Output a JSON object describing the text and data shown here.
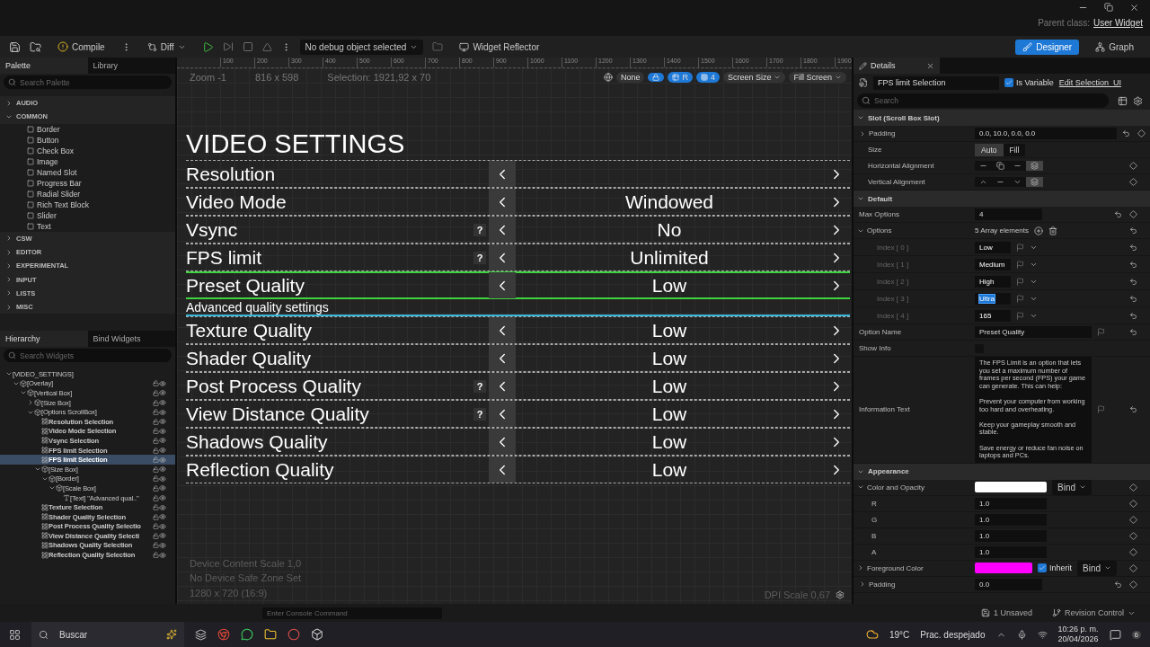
{
  "window": {
    "parent_class_label": "Parent class:",
    "parent_class": "User Widget",
    "modes": [
      {
        "label": "Designer",
        "selected": true
      },
      {
        "label": "Graph",
        "selected": false
      }
    ]
  },
  "toolbar": {
    "compile": "Compile",
    "diff": "Diff",
    "debug_object": "No debug object selected",
    "widget_reflector": "Widget Reflector"
  },
  "palette": {
    "tabs": [
      {
        "label": "Palette",
        "selected": true
      },
      {
        "label": "Library",
        "selected": false
      }
    ],
    "search_placeholder": "Search Palette",
    "categories": [
      {
        "label": "AUDIO",
        "expanded": false
      },
      {
        "label": "COMMON",
        "expanded": true,
        "items": [
          "Border",
          "Button",
          "Check Box",
          "Image",
          "Named Slot",
          "Progress Bar",
          "Radial Slider",
          "Rich Text Block",
          "Slider",
          "Text"
        ]
      },
      {
        "label": "CSW",
        "expanded": false
      },
      {
        "label": "EDITOR",
        "expanded": false
      },
      {
        "label": "EXPERIMENTAL",
        "expanded": false
      },
      {
        "label": "INPUT",
        "expanded": false
      },
      {
        "label": "LISTS",
        "expanded": false
      },
      {
        "label": "MISC",
        "expanded": false
      }
    ]
  },
  "hierarchy": {
    "tabs": [
      {
        "label": "Hierarchy",
        "selected": true
      },
      {
        "label": "Bind Widgets",
        "selected": false
      }
    ],
    "search_placeholder": "Search Widgets",
    "tree": [
      {
        "label": "[VIDEO_SETTINGS]",
        "selected": false,
        "expanded": true,
        "children": [
          {
            "label": "[Overlay]",
            "kind": "panel",
            "selected": false,
            "expanded": true,
            "children": [
              {
                "label": "[Vertical Box]",
                "kind": "panel",
                "selected": false,
                "expanded": true,
                "children": [
                  {
                    "label": "[Size Box]",
                    "kind": "panel",
                    "selected": false,
                    "expanded": false
                  },
                  {
                    "label": "[Options ScrollBox]",
                    "kind": "panel",
                    "selected": false,
                    "expanded": true,
                    "children": [
                      {
                        "label": "Resolution Selection",
                        "kind": "widget",
                        "selected": false
                      },
                      {
                        "label": "Video Mode Selection",
                        "kind": "widget",
                        "selected": false
                      },
                      {
                        "label": "Vsync Selection",
                        "kind": "widget",
                        "selected": false
                      },
                      {
                        "label": "FPS limit Selection",
                        "kind": "widget",
                        "selected": false
                      },
                      {
                        "label": "FPS limit Selection",
                        "kind": "widget",
                        "selected": true
                      },
                      {
                        "label": "[Size Box]",
                        "kind": "panel",
                        "selected": false,
                        "expanded": true,
                        "children": [
                          {
                            "label": "[Border]",
                            "kind": "panel",
                            "selected": false,
                            "expanded": true,
                            "children": [
                              {
                                "label": "[Scale Box]",
                                "kind": "panel",
                                "selected": false,
                                "expanded": true,
                                "children": [
                                  {
                                    "label": "[Text] \"Advanced qual..\"",
                                    "kind": "text",
                                    "selected": false
                                  }
                                ]
                              }
                            ]
                          }
                        ]
                      },
                      {
                        "label": "Texture Selection",
                        "kind": "widget",
                        "selected": false
                      },
                      {
                        "label": "Shader Quality  Selection",
                        "kind": "widget",
                        "selected": false
                      },
                      {
                        "label": "Post Process Quality Selectio",
                        "kind": "widget",
                        "selected": false
                      },
                      {
                        "label": "View Distance Quality Selecti",
                        "kind": "widget",
                        "selected": false
                      },
                      {
                        "label": "Shadows Quality Selection",
                        "kind": "widget",
                        "selected": false
                      },
                      {
                        "label": "Reflection Quality Selection",
                        "kind": "widget",
                        "selected": false
                      }
                    ]
                  }
                ]
              }
            ]
          }
        ]
      }
    ]
  },
  "canvas": {
    "ruler": [
      "100",
      "200",
      "300",
      "400",
      "500",
      "600",
      "700",
      "800",
      "900",
      "1000",
      "1100",
      "1200",
      "1300",
      "1400",
      "1500",
      "1600",
      "1700",
      "1800",
      "1900"
    ],
    "zoom": "Zoom -1",
    "size": "816 x 598",
    "selection": "Selection: 1921,92 x 70",
    "controls": {
      "scale_mode": "None",
      "r": "R",
      "grid": "4",
      "screen_size": "Screen Size",
      "fill": "Fill Screen"
    },
    "widget": {
      "title": "VIDEO SETTINGS",
      "rows": [
        {
          "kind": "option",
          "name": "Resolution",
          "selected": false
        },
        {
          "kind": "option",
          "name": "Video Mode",
          "value": "Windowed",
          "selected": false
        },
        {
          "kind": "option",
          "name": "Vsync",
          "help": "?",
          "value": "No",
          "selected": false
        },
        {
          "kind": "option",
          "name": "FPS limit",
          "help": "?",
          "value": "Unlimited",
          "selected": false
        },
        {
          "kind": "option",
          "name": "Preset Quality",
          "value": "Low",
          "selected": true
        },
        {
          "kind": "header",
          "name": "Advanced quality settings"
        },
        {
          "kind": "option",
          "name": "Texture Quality",
          "value": "Low",
          "selected": false
        },
        {
          "kind": "option",
          "name": "Shader Quality",
          "value": "Low",
          "selected": false
        },
        {
          "kind": "option",
          "name": "Post Process Quality",
          "help": "?",
          "value": "Low",
          "selected": false
        },
        {
          "kind": "option",
          "name": "View Distance Quality",
          "help": "?",
          "value": "Low",
          "selected": false
        },
        {
          "kind": "option",
          "name": "Shadows Quality",
          "value": "Low",
          "selected": false
        },
        {
          "kind": "option",
          "name": "Reflection Quality",
          "value": "Low",
          "selected": false
        }
      ]
    },
    "footer": [
      "Device Content Scale 1,0",
      "No Device Safe Zone Set",
      "1280 x 720 (16:9)"
    ],
    "dpi": "DPI Scale 0,67"
  },
  "details": {
    "tab": "Details",
    "name": "FPS limit Selection",
    "is_variable": {
      "label": "Is Variable",
      "checked": true
    },
    "edit_link": "Edit Selection_UI",
    "search_placeholder": "Search",
    "sections": [
      {
        "title": "Slot (Scroll Box Slot)",
        "expanded": true,
        "rows": [
          {
            "kind": "field",
            "label": "Padding",
            "value": "0.0, 10.0, 0.0, 0.0",
            "expanded": false
          },
          {
            "kind": "segmented",
            "label": "Size",
            "options": [
              {
                "label": "Auto",
                "selected": true
              },
              {
                "label": "Fill",
                "selected": false
              }
            ]
          },
          {
            "kind": "halign",
            "label": "Horizontal Alignment",
            "options": [
              {
                "selected": false
              },
              {
                "selected": false
              },
              {
                "selected": false
              },
              {
                "selected": true
              }
            ]
          },
          {
            "kind": "valign",
            "label": "Vertical Alignment",
            "options": [
              {
                "selected": false
              },
              {
                "selected": false
              },
              {
                "selected": false
              },
              {
                "selected": true
              }
            ]
          }
        ]
      },
      {
        "title": "Default",
        "expanded": true,
        "rows": [
          {
            "kind": "field",
            "label": "Max Options",
            "value": "4"
          },
          {
            "kind": "array",
            "label": "Options",
            "value": "5 Array elements",
            "expanded": true
          },
          {
            "kind": "index",
            "label": "Index [ 0 ]",
            "value": "Low",
            "selected": false
          },
          {
            "kind": "index",
            "label": "Index [ 1 ]",
            "value": "Medium",
            "selected": false
          },
          {
            "kind": "index",
            "label": "Index [ 2 ]",
            "value": "High",
            "selected": false
          },
          {
            "kind": "index",
            "label": "Index [ 3 ]",
            "value": "Ultra",
            "selected": true
          },
          {
            "kind": "index",
            "label": "Index [ 4 ]",
            "value": "165",
            "selected": false
          },
          {
            "kind": "name",
            "label": "Option Name",
            "value": "Preset Quality"
          },
          {
            "kind": "checkbox",
            "label": "Show Info",
            "checked": false
          },
          {
            "kind": "textarea",
            "label": "Information Text",
            "value": "The FPS Limit is an option that lets you set a maximum number of frames per second (FPS) your game can generate. This can help:\n\nPrevent your computer from working too hard and overheating.\n\nKeep your gameplay smooth and stable.\n\nSave energy or reduce fan noise on laptops and PCs."
          }
        ]
      },
      {
        "title": "Appearance",
        "expanded": true,
        "rows": [
          {
            "kind": "color",
            "label": "Color and Opacity",
            "color": "#ffffff",
            "bind": "Bind",
            "expanded": true
          },
          {
            "kind": "channel",
            "label": "R",
            "value": "1.0"
          },
          {
            "kind": "channel",
            "label": "G",
            "value": "1.0"
          },
          {
            "kind": "channel",
            "label": "B",
            "value": "1.0"
          },
          {
            "kind": "channel",
            "label": "A",
            "value": "1.0"
          },
          {
            "kind": "color",
            "label": "Foreground Color",
            "color": "#ff00ff",
            "bind": "Bind",
            "expanded": false,
            "inherit": {
              "label": "Inherit",
              "checked": true
            }
          },
          {
            "kind": "field",
            "label": "Padding",
            "value": "0.0",
            "expanded": false
          }
        ]
      }
    ]
  },
  "status_bar": {
    "console_placeholder": "Enter Console Command",
    "unsaved": "1 Unsaved",
    "revision": "Revision Control"
  },
  "taskbar": {
    "search": "Buscar",
    "temperature": "19°C",
    "weather": "Prac. despejado",
    "time": "10:26 p. m.",
    "date": "20/04/2026",
    "notifications": "6"
  }
}
